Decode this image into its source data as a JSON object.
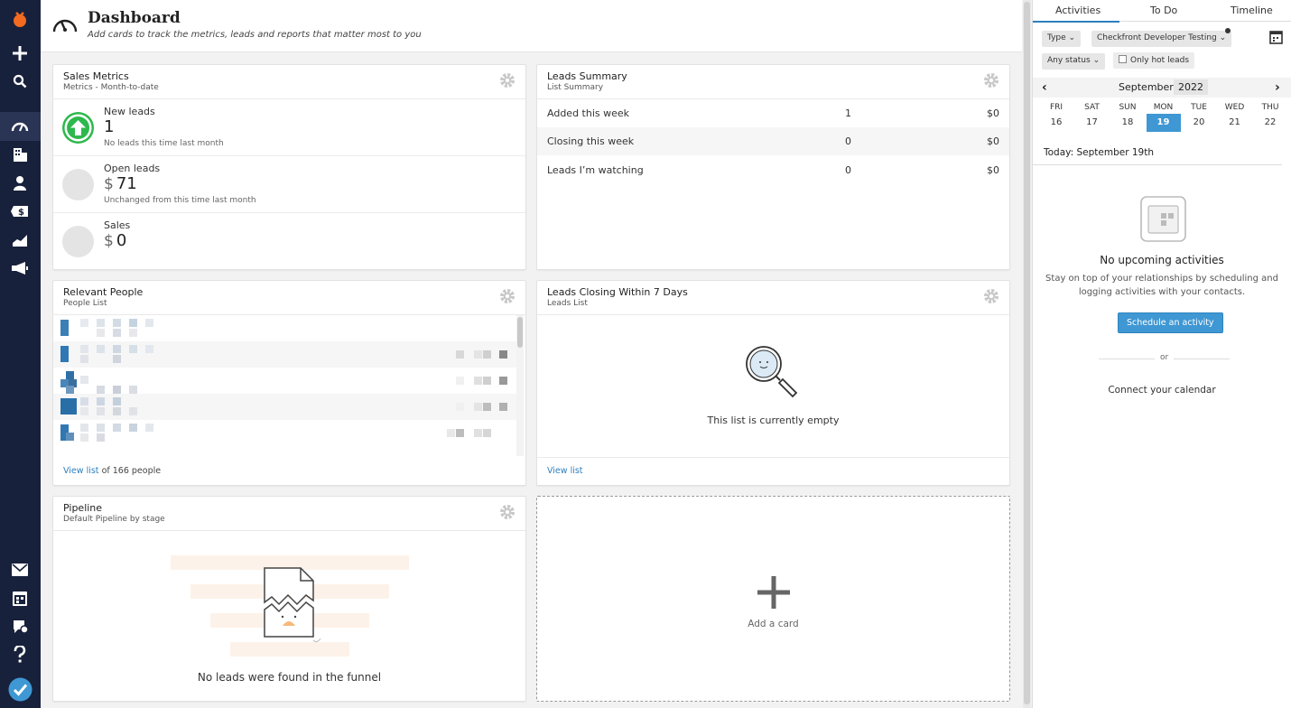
{
  "header": {
    "title": "Dashboard",
    "subtitle": "Add cards to track the metrics, leads and reports that matter most to you"
  },
  "sales_metrics": {
    "title": "Sales Metrics",
    "subtitle": "Metrics - Month-to-date",
    "rows": [
      {
        "label": "New leads",
        "currency": "",
        "value": "1",
        "note": "No leads this time last month",
        "icon": "arrow-up-circle-icon",
        "color": "#2db84c"
      },
      {
        "label": "Open leads",
        "currency": "$",
        "value": "71",
        "note": "Unchanged from this time last month",
        "icon": "neutral-circle-icon"
      },
      {
        "label": "Sales",
        "currency": "$",
        "value": "0",
        "note": "",
        "icon": "neutral-circle-icon"
      }
    ]
  },
  "leads_summary": {
    "title": "Leads Summary",
    "subtitle": "List Summary",
    "rows": [
      {
        "label": "Added this week",
        "count": "1",
        "amount": "$0"
      },
      {
        "label": "Closing this week",
        "count": "0",
        "amount": "$0"
      },
      {
        "label": "Leads I’m watching",
        "count": "0",
        "amount": "$0"
      }
    ]
  },
  "relevant_people": {
    "title": "Relevant People",
    "subtitle": "People List",
    "view_link": "View list",
    "count_text": "of 166 people"
  },
  "leads_closing": {
    "title": "Leads Closing Within 7 Days",
    "subtitle": "Leads List",
    "empty_text": "This list is currently empty",
    "view_link": "View list"
  },
  "pipeline": {
    "title": "Pipeline",
    "subtitle": "Default Pipeline by stage",
    "empty_text": "No leads were found in the funnel"
  },
  "add_card": {
    "label": "Add a card"
  },
  "right_panel": {
    "tabs": [
      "Activities",
      "To Do",
      "Timeline"
    ],
    "filters": {
      "type": "Type",
      "owner": "Checkfront Developer Testing",
      "status": "Any status",
      "hot_leads": "Only hot leads"
    },
    "calendar": {
      "month": "September",
      "year": "2022",
      "days": [
        {
          "name": "FRI",
          "num": "16"
        },
        {
          "name": "SAT",
          "num": "17"
        },
        {
          "name": "SUN",
          "num": "18"
        },
        {
          "name": "MON",
          "num": "19"
        },
        {
          "name": "TUE",
          "num": "20"
        },
        {
          "name": "WED",
          "num": "21"
        },
        {
          "name": "THU",
          "num": "22"
        }
      ],
      "selected_index": 3,
      "today_label": "Today: September 19th"
    },
    "empty": {
      "title": "No upcoming activities",
      "body_line1": "Stay on top of your relationships by scheduling and",
      "body_line2": "logging activities with your contacts.",
      "button": "Schedule an activity",
      "or": "or",
      "connect": "Connect your calendar"
    }
  },
  "colors": {
    "sidebar": "#18213b",
    "accent": "#3f97d3",
    "link": "#2c7fbf",
    "success": "#2db84c"
  }
}
